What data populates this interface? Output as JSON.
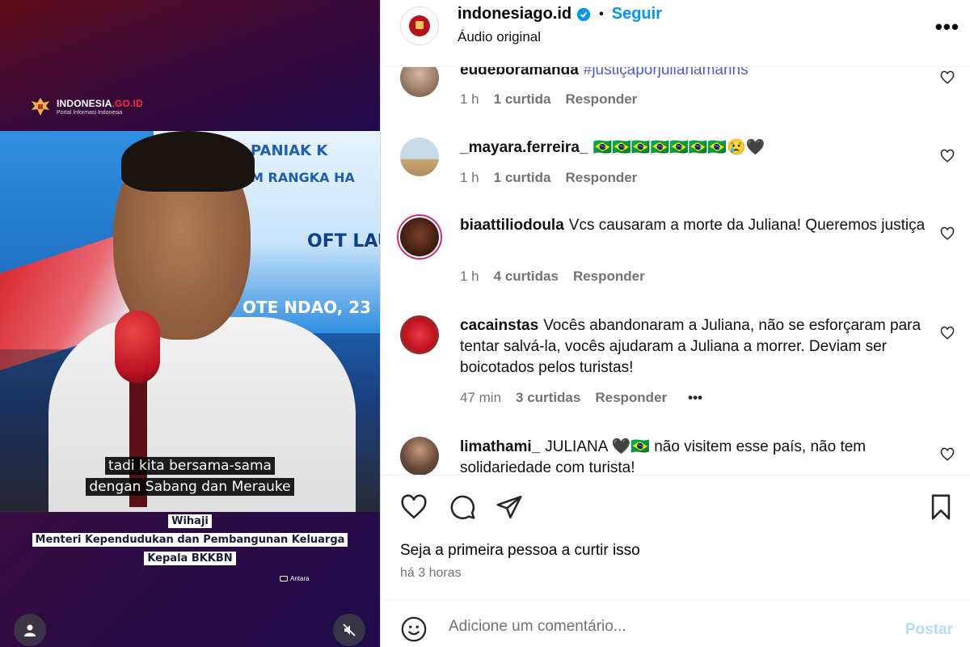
{
  "video": {
    "logo_brand": "INDONESIA",
    "logo_brand_accent": ".GO.ID",
    "logo_tagline": "Portal Informasi Indonesia",
    "banner_lines": [
      "PANIAK K",
      "M RANGKA HA",
      "OFT LAUN",
      "OTE NDAO, 23"
    ],
    "subtitle_lines": [
      "tadi kita bersama-sama",
      "dengan Sabang dan Merauke"
    ],
    "caption_lines": [
      "Wihaji",
      "Menteri Kependudukan dan Pembangunan Keluarga",
      "Kepala BKKBN"
    ],
    "source": "Antara"
  },
  "header": {
    "username": "indonesiago.id",
    "separator": "•",
    "follow_label": "Seguir",
    "audio_label": "Áudio original",
    "more_label": "•••"
  },
  "comments": [
    {
      "username": "eudeboramanda",
      "text": "#justiçaporjulianamarins",
      "time": "1 h",
      "likes": "1 curtida",
      "reply": "Responder"
    },
    {
      "username": "_mayara.ferreira_",
      "text": "🇧🇷🇧🇷🇧🇷🇧🇷🇧🇷🇧🇷🇧🇷😢🖤",
      "time": "1 h",
      "likes": "1 curtida",
      "reply": "Responder"
    },
    {
      "username": "biaattiliodoula",
      "text": "Vcs causaram a morte da Juliana! Queremos justiça",
      "time": "1 h",
      "likes": "4 curtidas",
      "reply": "Responder"
    },
    {
      "username": "cacainstas",
      "text": "Vocês abandonaram a Juliana, não se esforçaram para tentar salvá-la, vocês ajudaram a Juliana a morrer. Deviam ser boicotados pelos turistas!",
      "time": "47 min",
      "likes": "3 curtidas",
      "reply": "Responder",
      "more": "•••"
    },
    {
      "username": "limathami_",
      "text": "JULIANA 🖤🇧🇷 não visitem esse país, não tem solidariedade com turista!",
      "time": "",
      "likes": "",
      "reply": ""
    }
  ],
  "footer": {
    "likes_text": "Seja a primeira pessoa a curtir isso",
    "posted_time": "há 3 horas",
    "comment_placeholder": "Adicione um comentário...",
    "post_label": "Postar"
  },
  "colors": {
    "accent": "#0095f6",
    "muted": "#737373",
    "post_disabled": "#b3dbff"
  }
}
